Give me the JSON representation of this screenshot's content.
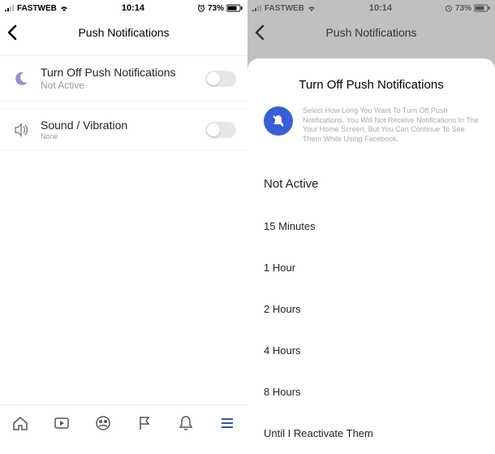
{
  "status": {
    "carrier": "FASTWEB",
    "time": "10:14",
    "battery": "73%"
  },
  "left": {
    "header_title": "Push Notifications",
    "rows": {
      "turn_off": {
        "title": "Turn Off Push Notifications",
        "sub": "Not Active"
      },
      "sound": {
        "title": "Sound / Vibration",
        "sub": "None"
      }
    }
  },
  "right": {
    "header_title": "Push Notifications",
    "modal_title": "Turn Off Push Notifications",
    "modal_desc": "Select How Long You Want To Turn Off Push Notifications. You Will Not Receive Notifications In The Your Home Screen, But You Can Continue To See Them While Using Facebook.",
    "options": [
      "Not Active",
      "15 Minutes",
      "1 Hour",
      "2 Hours",
      "4 Hours",
      "8 Hours",
      "Until I Reactivate Them"
    ]
  }
}
